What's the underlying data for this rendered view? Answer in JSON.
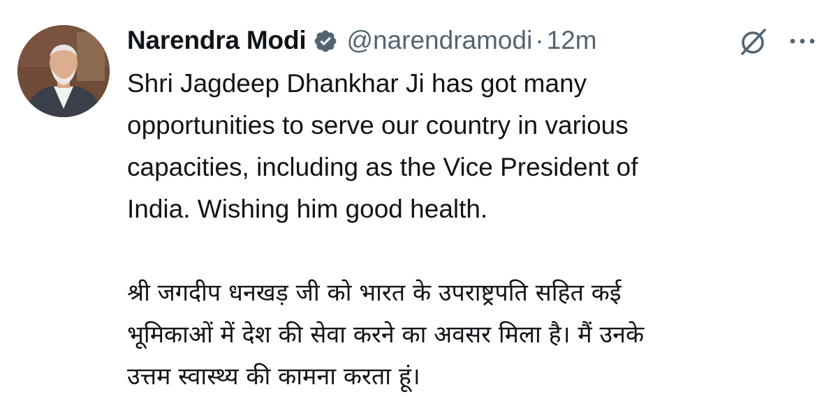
{
  "post": {
    "author": {
      "display_name": "Narendra Modi",
      "handle": "@narendramodi",
      "verified": true
    },
    "separator": "·",
    "timestamp": "12m",
    "text_en": "Shri Jagdeep Dhankhar Ji has got many\nopportunities to serve our country in various\ncapacities, including as the Vice President of\nIndia. Wishing him good health.",
    "text_hi": "श्री जगदीप धनखड़ जी को भारत के उपराष्ट्रपति सहित कई\nभूमिकाओं में देश की सेवा करने का अवसर मिला है। मैं उनके\nउत्तम स्वास्थ्य की कामना करता हूं।"
  },
  "icons": {
    "verified": "verified-badge-icon",
    "grok": "grok-icon",
    "more": "more-options-icon"
  },
  "colors": {
    "text_primary": "#0f1419",
    "text_secondary": "#536471",
    "background": "#ffffff"
  }
}
